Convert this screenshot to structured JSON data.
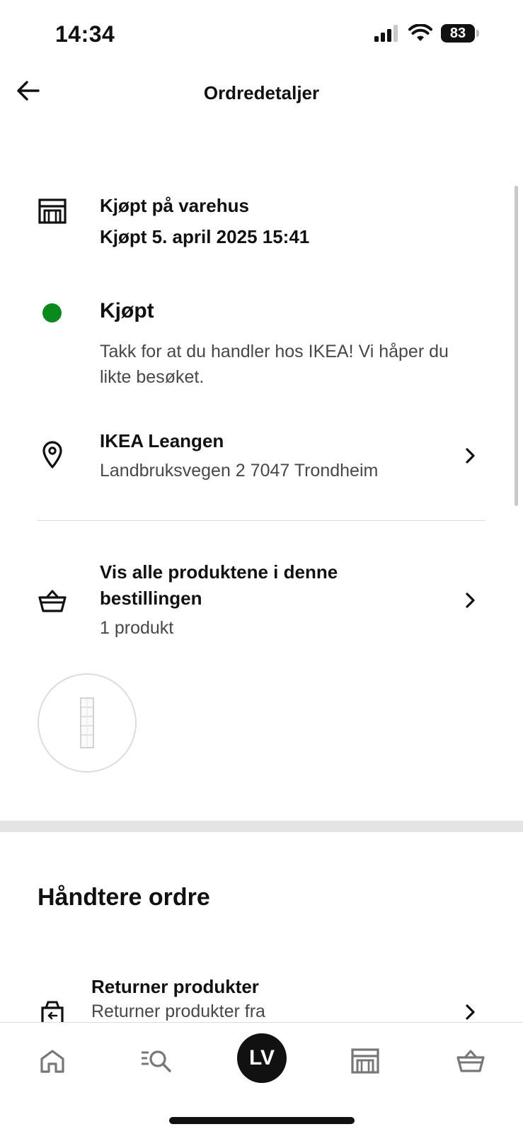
{
  "status_bar": {
    "time": "14:34",
    "battery": "83"
  },
  "header": {
    "title": "Ordredetaljer"
  },
  "purchase": {
    "type": "Kjøpt på varehus",
    "date": "Kjøpt 5. april 2025 15:41"
  },
  "status": {
    "label": "Kjøpt",
    "color": "#0a8a1c",
    "message_line1": "Takk for at du handler hos IKEA! Vi håper du",
    "message_line2": "likte besøket."
  },
  "store": {
    "name": "IKEA Leangen",
    "address": "Landbruksvegen 2 7047 Trondheim"
  },
  "products": {
    "title_line1": "Vis alle produktene i denne",
    "title_line2": "bestillingen",
    "count": "1 produkt"
  },
  "manage": {
    "title": "Håndtere ordre",
    "return_title": "Returner produkter",
    "return_sub": "Returner produkter fra"
  },
  "bottom_nav": {
    "avatar_initials": "LV",
    "items": [
      "home-icon",
      "search-icon",
      "avatar",
      "store-icon",
      "basket-icon"
    ]
  }
}
